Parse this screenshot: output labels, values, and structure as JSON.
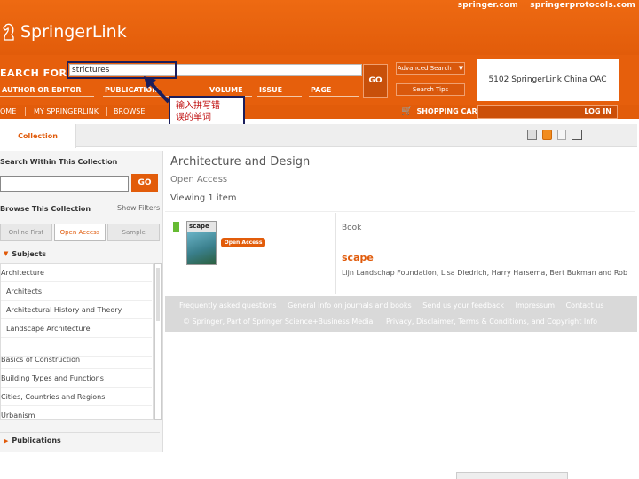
{
  "top_links": {
    "springer": "springer.com",
    "protocols": "springerprotocols.com"
  },
  "logo": {
    "text": "SpringerLink"
  },
  "search": {
    "label": "EARCH FOR",
    "query": "strictures",
    "go": "GO",
    "advanced": "Advanced Search",
    "tips": "Search Tips",
    "fields": [
      "AUTHOR OR EDITOR",
      "PUBLICATION",
      "VOLUME",
      "ISSUE",
      "PAGE"
    ]
  },
  "institution": "5102 SpringerLink China OAC",
  "nav": {
    "items": [
      "OME",
      "MY SPRINGERLINK",
      "BROWSE"
    ],
    "cart": "SHOPPING CART",
    "login": "LOG IN"
  },
  "annotation": {
    "line1": "输入拼写错",
    "line2": "误的单词"
  },
  "tabs": {
    "collection": "Collection"
  },
  "toolbar": {
    "icons": [
      "save-icon",
      "rss-icon",
      "export-icon",
      "print-icon"
    ]
  },
  "sidebar": {
    "search_within": "Search Within This Collection",
    "go": "GO",
    "browse": "Browse This Collection",
    "show_filters": "Show Filters",
    "filter_tabs": [
      "Online First",
      "Open Access",
      "Sample"
    ],
    "subjects_head": "Subjects",
    "subjects": [
      "Architecture",
      "Architects",
      "Architectural History and Theory",
      "Landscape Architecture",
      "",
      "Basics of Construction",
      "Building Types and Functions",
      "Cities, Countries and Regions",
      "Urbanism"
    ],
    "publications_head": "Publications"
  },
  "main": {
    "title": "Architecture and Design",
    "open_access": "Open Access",
    "viewing": "Viewing 1 item"
  },
  "result": {
    "type": "Book",
    "cover_title": "scape",
    "badge": "Open Access",
    "title": "scape",
    "authors": "Lijn Landschap Foundation, Lisa Diedrich, Harry Harsema, Bert Bukman and Rob"
  },
  "footer": {
    "links": [
      "Frequently asked questions",
      "General info on journals and books",
      "Send us your feedback",
      "Impressum",
      "Contact us"
    ],
    "copyright": "© Springer, Part of Springer Science+Business Media",
    "legal": "Privacy, Disclaimer, Terms & Conditions, and Copyright Info"
  },
  "colors": {
    "brand_orange": "#e25c0a",
    "annotation_red": "#c01010",
    "callout_navy": "#1b1e5c",
    "open_access_green": "#66bb33"
  }
}
